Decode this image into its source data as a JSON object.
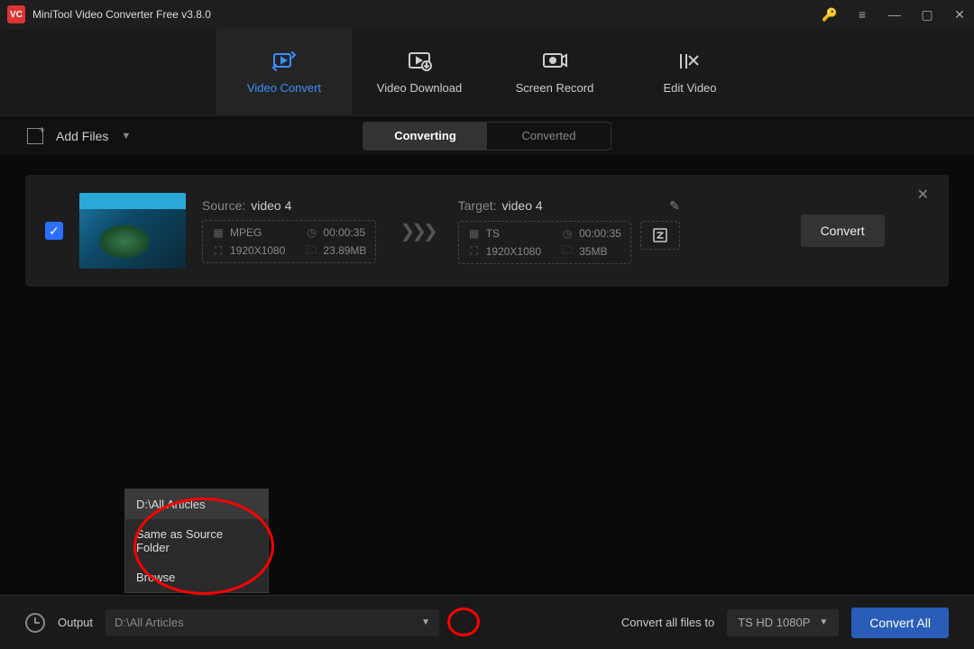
{
  "window": {
    "title": "MiniTool Video Converter Free v3.8.0"
  },
  "tabs": [
    {
      "label": "Video Convert"
    },
    {
      "label": "Video Download"
    },
    {
      "label": "Screen Record"
    },
    {
      "label": "Edit Video"
    }
  ],
  "toolbar": {
    "add_files": "Add Files",
    "segments": {
      "converting": "Converting",
      "converted": "Converted"
    }
  },
  "file": {
    "source_label": "Source:",
    "source_name": "video 4",
    "source": {
      "format": "MPEG",
      "duration": "00:00:35",
      "resolution": "1920X1080",
      "size": "23.89MB"
    },
    "target_label": "Target:",
    "target_name": "video 4",
    "target": {
      "format": "TS",
      "duration": "00:00:35",
      "resolution": "1920X1080",
      "size": "35MB"
    },
    "convert": "Convert"
  },
  "output_menu": {
    "items": [
      "D:\\All Articles",
      "Same as Source Folder",
      "Browse"
    ]
  },
  "bottom": {
    "output_label": "Output",
    "output_path": "D:\\All Articles",
    "convert_all_label": "Convert all files to",
    "format_selected": "TS HD 1080P",
    "convert_all": "Convert All"
  }
}
